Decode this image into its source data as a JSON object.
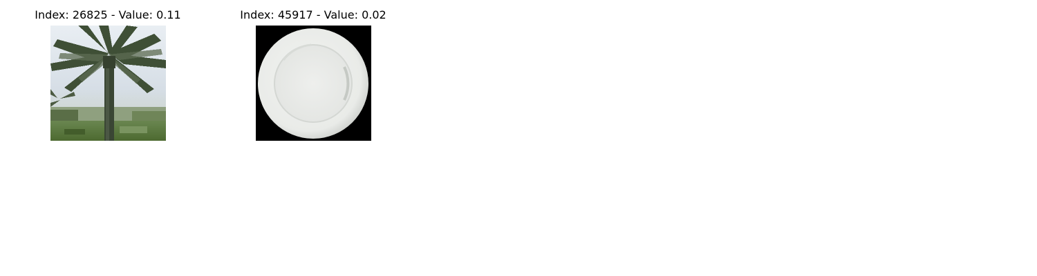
{
  "panels": [
    {
      "title": "Index: 26825 - Value: 0.11",
      "image": "palm-tree-image"
    },
    {
      "title": "Index: 45917 - Value: 0.02",
      "image": "white-plate-image"
    }
  ],
  "colors": {
    "background": "#ffffff",
    "title_text": "#000000",
    "plate_background": "#000000",
    "plate": "#eef0ed",
    "sky": "#dfe6ee",
    "foliage": "#4a5a3c",
    "grass": "#5b7a3a"
  }
}
